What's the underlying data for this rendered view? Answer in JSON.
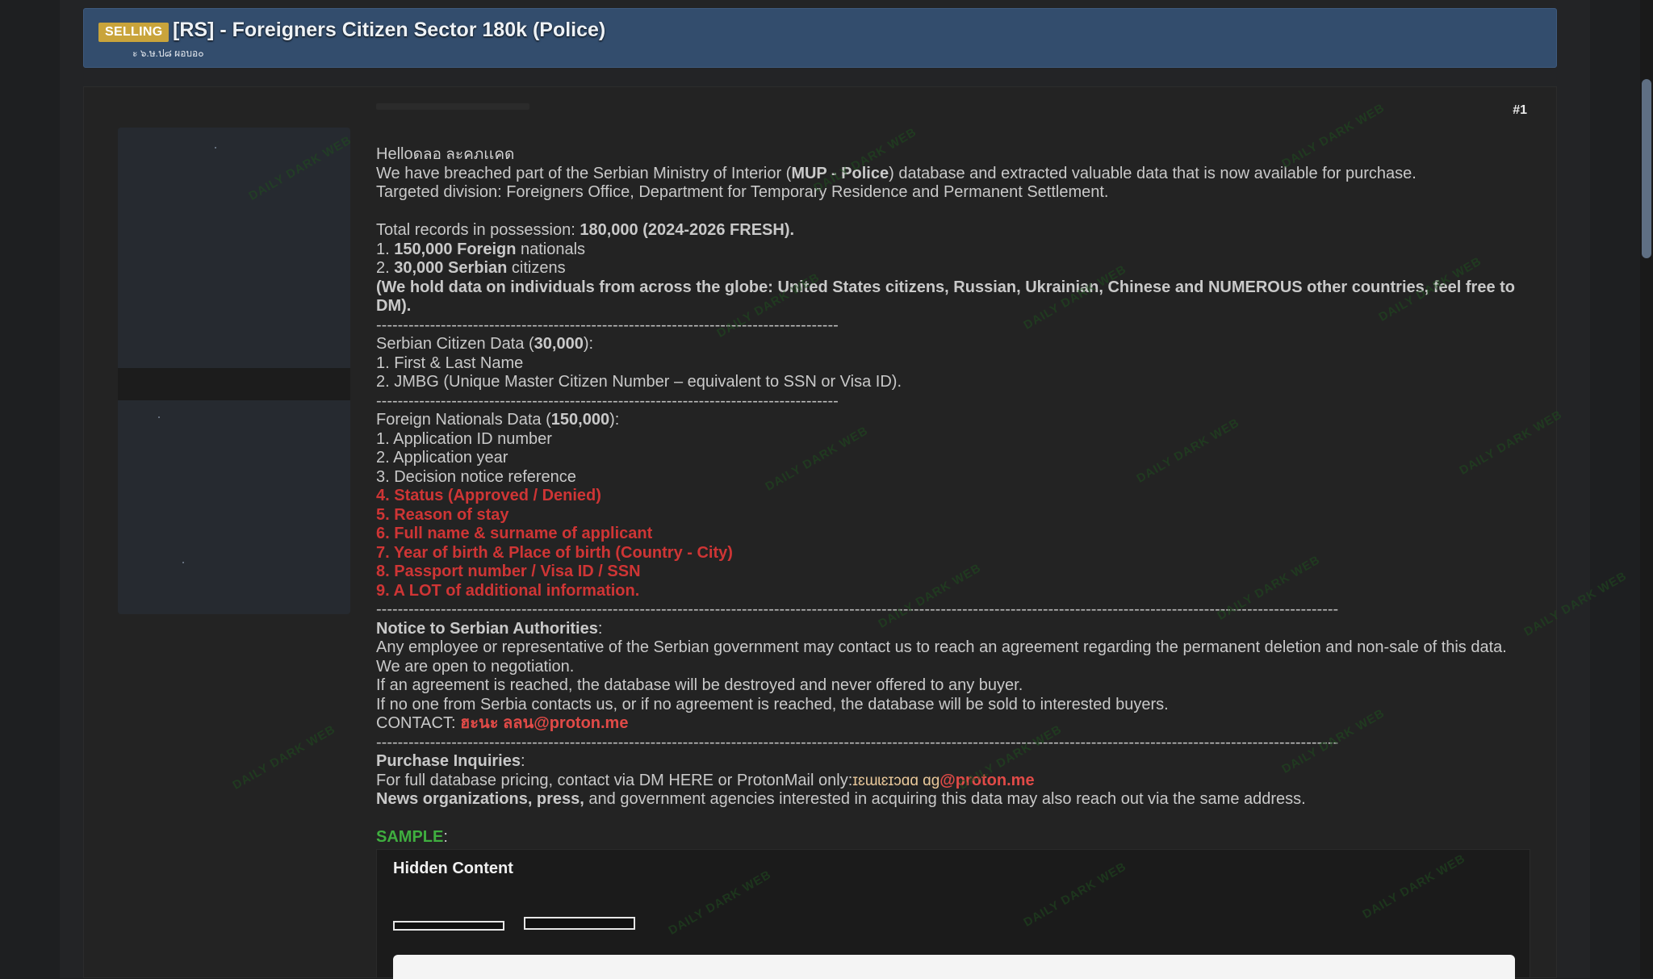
{
  "thread": {
    "prefix": "SELLING",
    "title": "[RS] - Foreigners Citizen Sector 180k (Police)",
    "subtitle": "ะ ๖.ษ.ป๘ ผอบอ๐"
  },
  "post": {
    "number": "#1",
    "greeting": "Hello",
    "greeting_name": "ดลอ ละคภเเคด",
    "intro_1_a": "We have breached part of the Serbian Ministry of Interior (",
    "intro_1_b": "MUP - Police",
    "intro_1_c": ") database and extracted valuable data that is now available for purchase.",
    "intro_2": "Targeted division: Foreigners Office, Department for Temporary Residence and Permanent Settlement.",
    "total_a": "Total records in possession: ",
    "total_b": "180,000 (2024-2026 FRESH).",
    "count_1_a": "1. ",
    "count_1_b": "150,000 Foreign",
    "count_1_c": " nationals",
    "count_2_a": "2. ",
    "count_2_b": "30,000 Serbian",
    "count_2_c": " citizens",
    "global_note": "(We hold data on individuals from across the globe: United States citizens, Russian, Ukrainian, Chinese and NUMEROUS other countries, feel free to DM).",
    "separator_short": "--------------------------------------------------------------------------------------",
    "separator_long": "-----------------------------------------------------------------------------------------------------------------------------------------------------------------------------------",
    "serbian_head_a": "Serbian Citizen Data (",
    "serbian_head_b": "30,000",
    "serbian_head_c": "):",
    "serbian_items": [
      "1. First & Last Name",
      "2. JMBG (Unique Master Citizen Number – equivalent to SSN or Visa ID)."
    ],
    "foreign_head_a": "Foreign Nationals Data (",
    "foreign_head_b": "150,000",
    "foreign_head_c": "):",
    "foreign_items": [
      "1. Application ID number",
      "2. Application year",
      "3. Decision notice reference"
    ],
    "foreign_items_red": [
      "4. Status (Approved / Denied)",
      "5. Reason of stay",
      "6. Full name & surname of applicant",
      "7. Year of birth & Place of birth (Country - City)",
      "8. Passport number / Visa ID / SSN",
      "9. A LOT of additional information."
    ],
    "notice_head": "Notice to Serbian Authorities",
    "colon": ":",
    "notice_lines": [
      "Any employee or representative of the Serbian government may contact us to reach an agreement regarding the permanent deletion and non-sale of this data.",
      "We are open to negotiation.",
      "If an agreement is reached, the database will be destroyed and never offered to any buyer.",
      "If no one from Serbia contacts us, or if no agreement is reached, the database will be sold to interested buyers."
    ],
    "contact_label": "CONTACT:  ",
    "contact_scribble": "ฮะนะ ลลน",
    "contact_email": "@proton.me",
    "purchase_head": "Purchase Inquiries",
    "purchase_line_a": "For full database pricing, contact via DM HERE or ProtonMail only:",
    "purchase_scribble": "ɪɛɯɩɛɪɔɑɑ ɑɡ",
    "purchase_email": "@proton.me",
    "news_a": "News organizations, press,",
    "news_b": " and government agencies interested in acquiring this data may also reach out via the same address.",
    "sample_label": "SAMPLE",
    "hidden_title": "Hidden Content"
  },
  "watermark": "DAILY DARK WEB",
  "colors": {
    "header_bg": "#334d6d",
    "prefix_bg": "#c9a43b",
    "red": "#cf3535",
    "green": "#3fae3f",
    "scroll_thumb": "#5f6f83"
  }
}
